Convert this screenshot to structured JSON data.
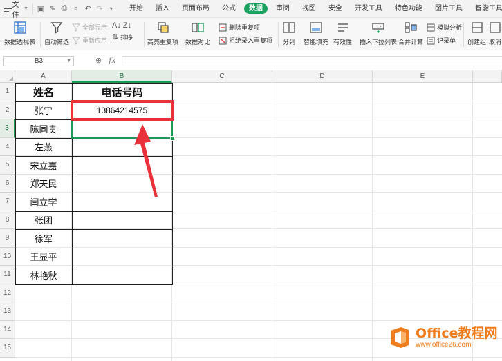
{
  "menu": {
    "file_label": "文件",
    "tabs": [
      "开始",
      "插入",
      "页面布局",
      "公式",
      "数据",
      "审阅",
      "视图",
      "安全",
      "开发工具",
      "特色功能",
      "图片工具",
      "智能工具箱"
    ],
    "active_tab": "数据"
  },
  "ribbon": {
    "pivot": "数据透视表",
    "autofilter": "自动筛选",
    "show_all": "全部显示",
    "reapply": "重新应用",
    "sort": "排序",
    "highlight_dup": "高亮重复项",
    "compare": "数据对比",
    "remove_dup": "删除重复项",
    "reject_dup": "拒绝录入重复项",
    "split": "分列",
    "smart_fill": "智能填充",
    "validity": "有效性",
    "insert_dropdown": "插入下拉列表",
    "merge_calc": "合并计算",
    "simulate": "模拟分析",
    "record": "记录单",
    "create_group": "创建组",
    "ungroup": "取消"
  },
  "formula_bar": {
    "cell_ref": "B3",
    "fx_label": "fx",
    "value": ""
  },
  "sheet": {
    "columns": [
      "A",
      "B",
      "C",
      "D",
      "E"
    ],
    "rows": [
      "1",
      "2",
      "3",
      "4",
      "5",
      "6",
      "7",
      "8",
      "9",
      "10",
      "11",
      "12",
      "13",
      "14",
      "15"
    ],
    "header_name": "姓名",
    "header_phone": "电话号码",
    "names": [
      "张宁",
      "陈同贵",
      "左燕",
      "宋立嘉",
      "郑天民",
      "闫立学",
      "张团",
      "徐军",
      "王显平",
      "林艳秋"
    ],
    "phones": [
      "13864214575",
      "",
      "",
      "",
      "",
      "",
      "",
      "",
      "",
      ""
    ]
  },
  "watermark": {
    "brand": "Office教程网",
    "url": "www.office26.com"
  },
  "colors": {
    "accent_green": "#1aa260",
    "highlight_red": "#e8313a",
    "watermark_orange": "#f07d1d"
  }
}
